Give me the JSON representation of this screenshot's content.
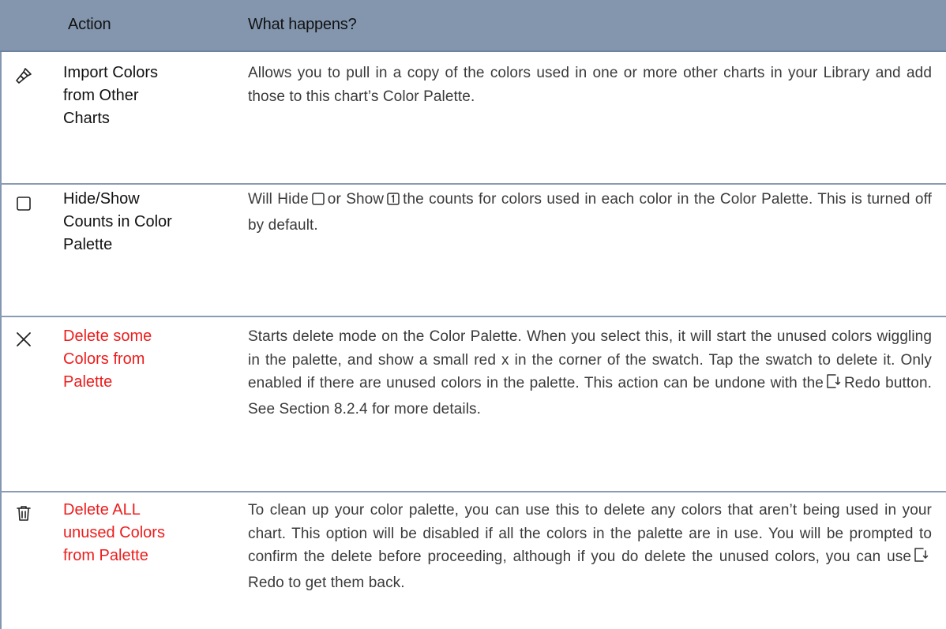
{
  "header": {
    "col_action": "Action",
    "col_what": "What happens?"
  },
  "rows": [
    {
      "icon": "paintbrush-icon",
      "action": "Import Colors\nfrom Other\nCharts",
      "desc": "Allows you to pull in a copy of the colors used in one or more other charts in your Library and add those to this chart’s Color Palette."
    },
    {
      "icon": "square-outline-icon",
      "action": "Hide/Show\nCounts in Color\nPalette",
      "desc_parts": [
        "Will Hide",
        "or Show",
        "the counts for colors used in each color in the Color Palette. This is turned off by default."
      ],
      "inline_icons": [
        "square-outline-icon",
        "square-one-icon"
      ]
    },
    {
      "icon": "x-icon",
      "action": "Delete some\nColors from\nPalette",
      "action_color": "#ee1c1c",
      "desc_parts": [
        "Starts delete mode on the Color Palette. When you select this, it will start the unused colors wiggling in the palette, and show a small red x in the corner of the swatch. Tap the swatch to delete it. Only enabled if there are unused colors in the palette. This action can be undone with the",
        "Redo button. See Section 8.2.4 for more details."
      ],
      "inline_icons": [
        "redo-icon"
      ]
    },
    {
      "icon": "trash-icon",
      "action": "Delete ALL\nunused Colors\nfrom Palette",
      "action_color": "#ee1c1c",
      "desc_parts": [
        "To clean up your color palette, you can use this to delete any colors that aren’t being used in your chart. This option will be disabled if all the colors in the palette are in use. You will be prompted to confirm the delete before proceeding, although if you do delete the unused colors, you can use",
        "Redo to get them back."
      ],
      "inline_icons": [
        "redo-icon"
      ]
    }
  ]
}
